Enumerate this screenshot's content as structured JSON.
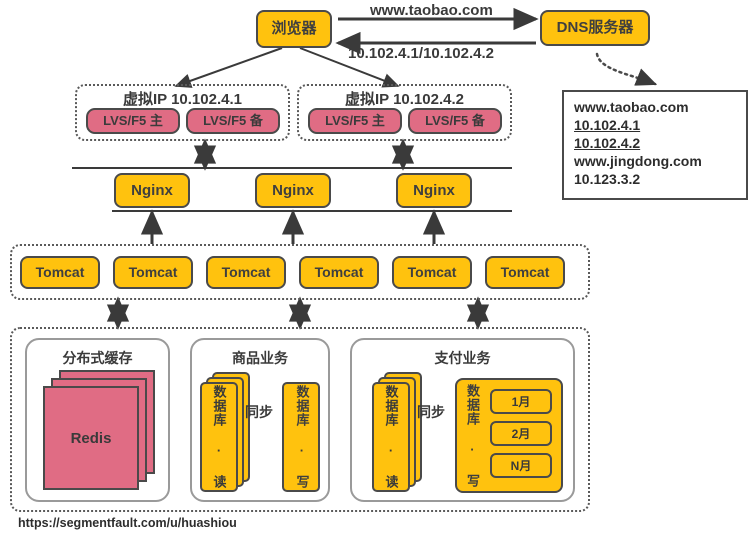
{
  "diagram": {
    "title": "taobao-architecture-diagram",
    "colors": {
      "amber": "#ffc20e",
      "pink": "#e06c84",
      "outline": "#4a4a4a",
      "text": "#3a3a3a"
    }
  },
  "top": {
    "browser": "浏览器",
    "dns_server": "DNS服务器",
    "request_label": "www.taobao.com",
    "response_label": "10.102.4.1/10.102.4.2"
  },
  "dns_records": {
    "lines": [
      {
        "text": "www.taobao.com",
        "underline": false
      },
      {
        "text": "10.102.4.1",
        "underline": true
      },
      {
        "text": "10.102.4.2",
        "underline": true
      },
      {
        "text": "www.jingdong.com",
        "underline": false
      },
      {
        "text": "10.123.3.2",
        "underline": false
      }
    ]
  },
  "vip_groups": [
    {
      "title": "虚拟IP 10.102.4.1",
      "nodes": [
        "LVS/F5 主",
        "LVS/F5 备"
      ]
    },
    {
      "title": "虚拟IP 10.102.4.2",
      "nodes": [
        "LVS/F5 主",
        "LVS/F5 备"
      ]
    }
  ],
  "nginx": {
    "nodes": [
      "Nginx",
      "Nginx",
      "Nginx"
    ]
  },
  "tomcat": {
    "nodes": [
      "Tomcat",
      "Tomcat",
      "Tomcat",
      "Tomcat",
      "Tomcat",
      "Tomcat"
    ]
  },
  "services": {
    "cache": {
      "title": "分布式缓存",
      "node": "Redis"
    },
    "product": {
      "title": "商品业务",
      "read_db": "数据库 · 读",
      "write_db": "数据库 · 写",
      "sync_label": "同步"
    },
    "payment": {
      "title": "支付业务",
      "read_db": "数据库 · 读",
      "write_db": "数据库 · 写",
      "sync_label": "同步",
      "partitions": [
        "1月",
        "2月",
        "N月"
      ]
    }
  },
  "footer": {
    "url": "https://segmentfault.com/u/huashiou"
  }
}
